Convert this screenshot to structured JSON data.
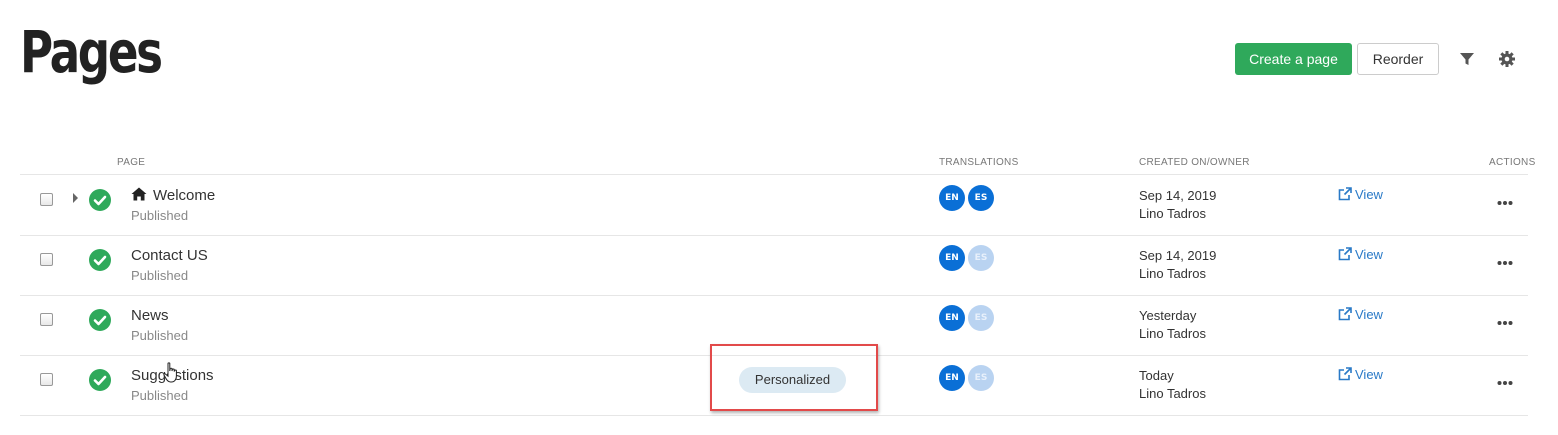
{
  "header": {
    "title": "Pages",
    "create_label": "Create a page",
    "reorder_label": "Reorder",
    "filter_icon": "filter-icon",
    "settings_icon": "gear-icon"
  },
  "columns": {
    "page": "PAGE",
    "translations": "TRANSLATIONS",
    "created": "CREATED ON/OWNER",
    "actions": "ACTIONS"
  },
  "colors": {
    "primary_button": "#2fa95b",
    "status_published": "#2fa95b",
    "lang_active": "#0a6fd6",
    "lang_inactive": "#b9d3f1",
    "link": "#2a7ac7",
    "highlight_box": "#e24a4a"
  },
  "rows": [
    {
      "name": "Welcome",
      "status": "Published",
      "home": true,
      "expandable": true,
      "tag": "",
      "langs": [
        "EN",
        "ES"
      ],
      "es_active": true,
      "date": "Sep 14, 2019",
      "owner": "Lino Tadros",
      "view_label": "View"
    },
    {
      "name": "Contact US",
      "status": "Published",
      "home": false,
      "expandable": false,
      "tag": "",
      "langs": [
        "EN",
        "ES"
      ],
      "es_active": false,
      "date": "Sep 14, 2019",
      "owner": "Lino Tadros",
      "view_label": "View"
    },
    {
      "name": "News",
      "status": "Published",
      "home": false,
      "expandable": false,
      "tag": "",
      "langs": [
        "EN",
        "ES"
      ],
      "es_active": false,
      "date": "Yesterday",
      "owner": "Lino Tadros",
      "view_label": "View"
    },
    {
      "name": "Suggestions",
      "status": "Published",
      "home": false,
      "expandable": false,
      "tag": "Personalized",
      "langs": [
        "EN",
        "ES"
      ],
      "es_active": false,
      "date": "Today",
      "owner": "Lino Tadros",
      "view_label": "View"
    }
  ]
}
